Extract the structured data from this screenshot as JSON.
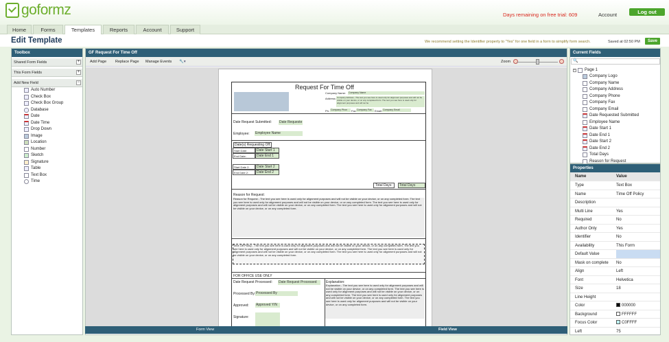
{
  "header": {
    "logo_text": "goformz",
    "trial_text": "Days remaining on free trial: 609",
    "account_label": "Account",
    "logout_label": "Log out"
  },
  "nav": {
    "tabs": [
      {
        "label": "Home"
      },
      {
        "label": "Forms"
      },
      {
        "label": "Templates"
      },
      {
        "label": "Reports"
      },
      {
        "label": "Account"
      },
      {
        "label": "Support"
      }
    ],
    "active": "Templates"
  },
  "page": {
    "title": "Edit Template",
    "recommend": "We recommend setting the Identifier property to \"Yes\" for one field in a form to simplify form search.",
    "saved": "Saved at 02:50 PM",
    "save_label": "Save"
  },
  "toolbox": {
    "title": "Toolbox",
    "sections": [
      "Shared Form Fields",
      "This Form Fields",
      "Add New Field"
    ],
    "items": [
      "Auto Number",
      "Check Box",
      "Check Box Group",
      "Database",
      "Date",
      "Date Time",
      "Drop Down",
      "Image",
      "Location",
      "Number",
      "Sketch",
      "Signature",
      "Table",
      "Text Box",
      "Time"
    ]
  },
  "canvas": {
    "title": "GF Request For Time Off",
    "tools": [
      "Add Page",
      "Replace Page",
      "Manage Events"
    ],
    "zoom_label": "Zoom",
    "bottom_left": "Form View",
    "bottom_right": "Field View"
  },
  "form": {
    "title": "Request For Time Off",
    "company_name_lbl": "Company Name:",
    "company_name_fld": "Company Name",
    "address_lbl": "Address:",
    "address_fld": "Company Address - The text you see here is used only for alignment purposes and will not be visible on your device, or on any completed form. The text you see here is used only for alignment purposes and will not be",
    "ph_lbl": "Ph:",
    "ph_fld": "Company Phon",
    "fax_lbl": "Fax:",
    "fax_fld": "Company Fax",
    "email_lbl": "Email:",
    "email_fld": "Company Email",
    "date_req_lbl": "Date Request Submitted:",
    "date_req_fld": "Date Requeste",
    "employee_lbl": "Employee:",
    "employee_fld": "Employee Name",
    "dates_lbl": "Date(s) Requesting Off:",
    "start_date": "Start Date:",
    "start_fld": "Date Start 1",
    "end_date": "End Date:",
    "end_fld": "Date End 1",
    "start_date2": "Start Date 2:",
    "start_fld2": "Date Start 2",
    "end_date2": "End Date 2:",
    "end_fld2": "Date End 2",
    "total_days_lbl": "Total Days:",
    "total_days_fld": "Total Days",
    "reason_lbl": "Reason for Request:",
    "reason_text": "Reason for Request - The text you see here is used only for alignment purposes and will not be visible on your device, or on any completed form. The text you see here is used only for alignment purposes and will not be visible on your device, or on any completed form. The text you see here is used only for alignment purposes and will not be visible on your device, or on any completed form. The text you see here is used only for alignment purposes and will not be visible on your device, or on any completed form.",
    "policy_text": "Time Off Policy - The text you see here is used only for alignment purposes and will not be visible on your device, or on any completed form. The text you see here is used only for alignment purposes and will not be visible on your device, or on any completed form. The text you see here is used only for alignment purposes and will not be visible on your device, or on any completed form. The text you see here is used only for alignment purposes and will not be visible on your device, or on any completed form.",
    "office_lbl": "FOR OFFICE USE ONLY",
    "dr_processed_lbl": "Date Request Processed:",
    "dr_processed_fld": "Date Request Processed",
    "processed_by_lbl": "Processed By:",
    "processed_by_fld": "Processed By",
    "approved_lbl": "Approved:",
    "approved_fld": "Approved Y/N",
    "signature_lbl": "Signature:",
    "explanation_lbl": "Explanation:",
    "explanation_text": "Explanation - The text you see here is used only for alignment purposes and will not be visible on your device, or on any completed form. The text you see here is used only for alignment purposes and will not be visible on your device, or on any completed form. The text you see here is used only for alignment purposes and will not be visible on your device, or on any completed form. The text you see here is used only for alignment purposes and will not be visible on your device, or on any completed form."
  },
  "current_fields": {
    "title": "Current Fields",
    "page": "Page 1",
    "items": [
      "Company Logo",
      "Company Name",
      "Company Address",
      "Company Phone",
      "Company Fax",
      "Company Email",
      "Date Requested Submitted",
      "Employee Name",
      "Date Start 1",
      "Date End 1",
      "Date Start 2",
      "Date End 2",
      "Total Days",
      "Reason for Request"
    ]
  },
  "properties": {
    "title": "Properties",
    "col_name": "Name",
    "col_value": "Value",
    "rows": [
      {
        "name": "Type",
        "value": "Text Box"
      },
      {
        "name": "Name",
        "value": "Time Off Policy"
      },
      {
        "name": "Description",
        "value": ""
      },
      {
        "name": "Multi Line",
        "value": "Yes"
      },
      {
        "name": "Required",
        "value": "No"
      },
      {
        "name": "Author Only",
        "value": "Yes"
      },
      {
        "name": "Identifier",
        "value": "No"
      },
      {
        "name": "Availability",
        "value": "This Form"
      },
      {
        "name": "Default Value",
        "value": ""
      },
      {
        "name": "Mask on complete",
        "value": "No"
      },
      {
        "name": "Align",
        "value": "Left"
      },
      {
        "name": "Font",
        "value": "Helvetica"
      },
      {
        "name": "Size",
        "value": "18"
      },
      {
        "name": "Line Height",
        "value": ""
      },
      {
        "name": "Color",
        "value": "000000"
      },
      {
        "name": "Background",
        "value": "FFFFFF"
      },
      {
        "name": "Focus Color",
        "value": "C0FFFF"
      },
      {
        "name": "Left",
        "value": "75"
      }
    ],
    "swatches": {
      "Color": "#000000",
      "Background": "#FFFFFF",
      "Focus Color": "#C0FFFF"
    }
  }
}
